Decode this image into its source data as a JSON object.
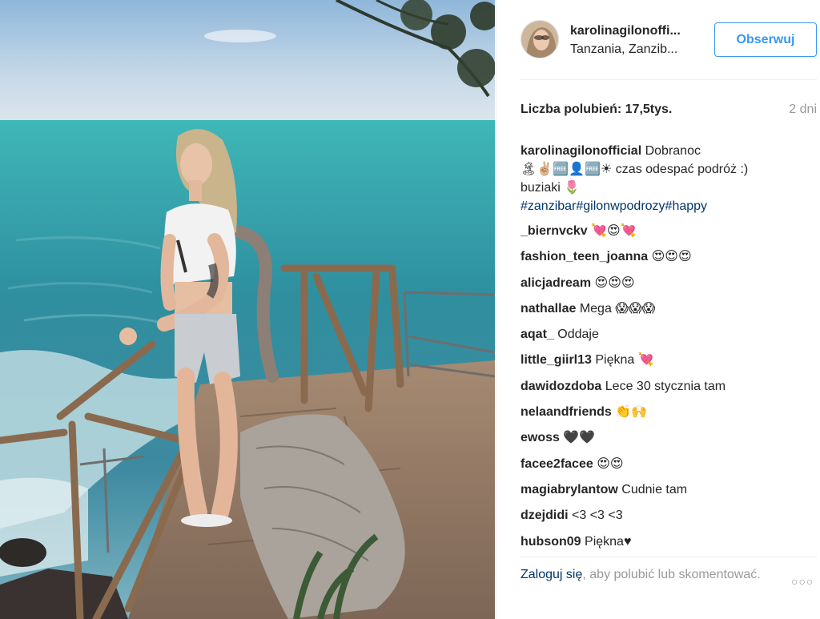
{
  "header": {
    "username": "karolinagilonoffi...",
    "location": "Tanzania, Zanzib...",
    "follow_label": "Obserwuj"
  },
  "meta": {
    "likes": "Liczba polubień: 17,5tys.",
    "time_ago": "2 dni"
  },
  "caption": {
    "user": "karolinagilonofficial",
    "text_line1": "Dobranoc",
    "text_line2": "🏝✌🏼🆓👤🆓☀ czas odespać podróż :)",
    "text_line3": "buziaki 🌷",
    "hashtags": "#zanzibar#gilonwpodrozy#happy"
  },
  "comments": [
    {
      "user": "_biernvckv",
      "text": "💘😍💘"
    },
    {
      "user": "fashion_teen_joanna",
      "text": "😍😍😍"
    },
    {
      "user": "alicjadream",
      "text": "😍😍😍"
    },
    {
      "user": "nathallae",
      "text": "Mega 😱😱😱"
    },
    {
      "user": "aqat_",
      "text": "Oddaje"
    },
    {
      "user": "little_giirl13",
      "text": "Piękna 💘"
    },
    {
      "user": "dawidozdoba",
      "text": "Lece 30 stycznia tam"
    },
    {
      "user": "nelaandfriends",
      "text": "👏🙌"
    },
    {
      "user": "ewoss",
      "text": "🖤🖤"
    },
    {
      "user": "facee2facee",
      "text": "😍😍"
    },
    {
      "user": "magiabrylantow",
      "text": "Cudnie tam"
    },
    {
      "user": "dzejdidi",
      "text": "<3 <3 <3"
    },
    {
      "user": "hubson09",
      "text": "Piękna♥"
    }
  ],
  "footer": {
    "login_link": "Zaloguj się",
    "login_rest": ", aby polubić lub skomentować.",
    "more_icon": "ellipsis-icon"
  },
  "colors": {
    "accent": "#3897f0",
    "link": "#003569",
    "muted": "#999999",
    "text": "#262626"
  }
}
